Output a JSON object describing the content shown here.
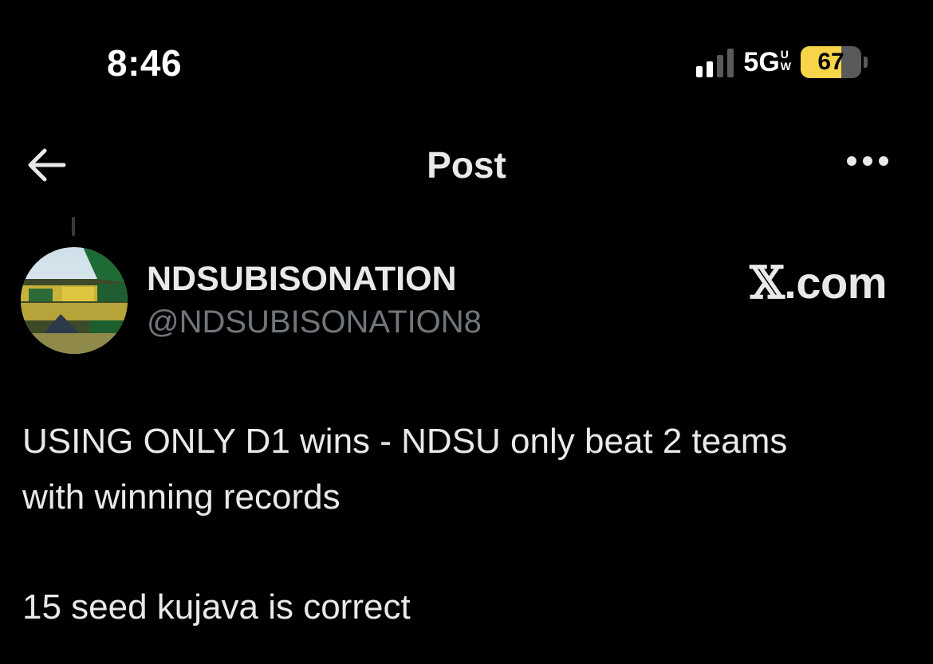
{
  "status_bar": {
    "time": "8:46",
    "network": "5G",
    "network_sup": "U",
    "network_sub": "W",
    "battery": "67",
    "battery_level": 0.67,
    "battery_color": "#f7d548",
    "signal_bars_active": 2,
    "signal_bars_total": 4
  },
  "header": {
    "title": "Post",
    "back_icon": "arrow-left-icon",
    "more_icon": "more-horizontal-icon"
  },
  "author": {
    "display_name": "NDSUBISONATION",
    "handle": "@NDSUBISONATION8"
  },
  "watermark": {
    "mark": "𝕏",
    "suffix": ".com"
  },
  "post": {
    "lines": [
      "USING ONLY D1 wins - NDSU only beat 2 teams",
      "with winning records",
      "15 seed kujava is correct"
    ]
  },
  "colors": {
    "background": "#000000",
    "text": "#e7e9ea",
    "secondary_text": "#71767b"
  }
}
